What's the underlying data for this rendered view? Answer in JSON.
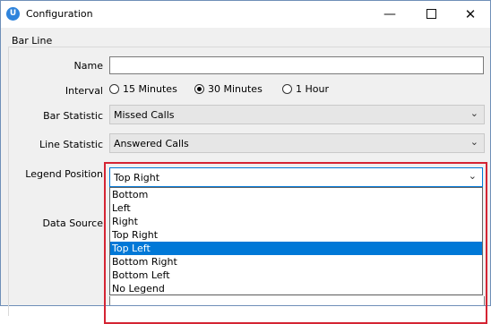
{
  "window": {
    "title": "Configuration",
    "icon_letter": "U",
    "min_glyph": "—",
    "close_glyph": "✕"
  },
  "group": {
    "title": "Bar Line"
  },
  "form": {
    "name_label": "Name",
    "name_value": "",
    "interval_label": "Interval",
    "interval_options": [
      "15 Minutes",
      "30 Minutes",
      "1 Hour"
    ],
    "interval_selected": "30 Minutes",
    "bar_statistic_label": "Bar Statistic",
    "bar_statistic_value": "Missed Calls",
    "line_statistic_label": "Line Statistic",
    "line_statistic_value": "Answered Calls",
    "legend_position_label": "Legend Position",
    "legend_position_value": "Top Right",
    "data_source_label": "Data Source"
  },
  "legend_dropdown": {
    "items": [
      "Bottom",
      "Left",
      "Right",
      "Top Right",
      "Top Left",
      "Bottom Right",
      "Bottom Left",
      "No Legend"
    ],
    "highlighted": "Top Left"
  },
  "colors": {
    "accent": "#0078d7",
    "highlight_border": "#d42433",
    "app_icon": "#2f84dc"
  }
}
